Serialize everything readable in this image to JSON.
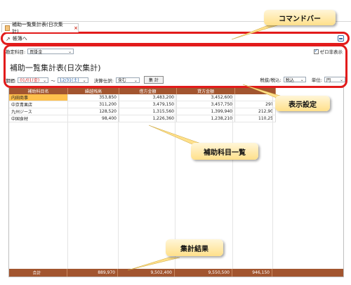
{
  "tab": {
    "title": "補助一覧集計表(日次集計)",
    "close": "×"
  },
  "command_bar": {
    "back_label": "帳簿へ"
  },
  "settings": {
    "account_label": "勘定科目:",
    "account_value": "買掛金",
    "zero_hide_label": "ゼロ非表示",
    "zero_hide_checked": true,
    "report_title": "補助一覧集計表(日次集計)",
    "period_label": "期間:",
    "date_from": "01/01(金)",
    "date_sep": "〜",
    "date_to": "12/31(土)",
    "closing_label": "決算仕訳:",
    "closing_value": "含む",
    "total_button": "集 計",
    "tax_label": "税抜/税込:",
    "tax_value": "税込",
    "unit_label": "単位:",
    "unit_value": "円"
  },
  "table": {
    "headers": [
      "補助科目名",
      "繰越残高",
      "借方金額",
      "貸方金額",
      ""
    ],
    "rows": [
      {
        "name": "内田商事",
        "carry": "353,850",
        "debit": "3,483,200",
        "credit": "3,452,600",
        "balance": ""
      },
      {
        "name": "中京青果店",
        "carry": "311,200",
        "debit": "3,479,150",
        "credit": "3,457,750",
        "balance": "29?"
      },
      {
        "name": "九州ジース",
        "carry": "128,520",
        "debit": "1,315,560",
        "credit": "1,399,940",
        "balance": "212,90"
      },
      {
        "name": "中国食材",
        "carry": "98,400",
        "debit": "1,226,360",
        "credit": "1,238,210",
        "balance": "110,25"
      }
    ],
    "footer": {
      "label": "合計",
      "carry": "889,970",
      "debit": "9,502,400",
      "credit": "9,550,500",
      "balance": "946,150"
    }
  },
  "callouts": {
    "command_bar": "コマンドバー",
    "display_settings": "表示設定",
    "subaccount_list": "補助科目一覧",
    "totals": "集計結果"
  }
}
